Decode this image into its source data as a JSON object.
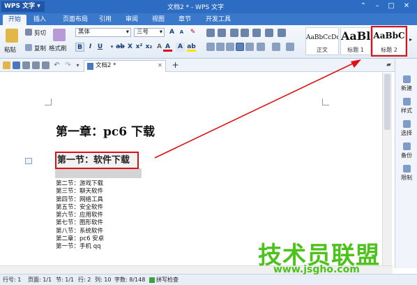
{
  "app": {
    "title": "WPS 文字",
    "doc_title": "文档2 * - WPS 文字"
  },
  "menu": [
    "开始",
    "插入",
    "页面布局",
    "引用",
    "审阅",
    "视图",
    "章节",
    "开发工具"
  ],
  "ribbon": {
    "paste": "粘贴",
    "cut": "剪切",
    "copy": "复制",
    "format_painter": "格式刷",
    "font": "黑体",
    "size": "三号",
    "styles": [
      {
        "sample": "AaBbCcDc",
        "label": "正文"
      },
      {
        "sample": "AaBl",
        "label": "标题 1"
      },
      {
        "sample": "AaBbC",
        "label": "标题 2"
      }
    ]
  },
  "doc_tab": "文档2 *",
  "sidebar": [
    "新建",
    "样式",
    "选择",
    "备份",
    "限制"
  ],
  "document": {
    "heading1": "第一章：pc6 下载",
    "heading2": "第一节：软件下载",
    "toc": [
      "第二节：游戏下载",
      "第三节：聊天软件",
      "第四节：网络工具",
      "第五节：安全软件",
      "第六节：应用软件",
      "第七节：图形软件",
      "第八节：系统软件",
      "第二章：pc6 安卓",
      "第一节：手机 qq"
    ]
  },
  "status": {
    "row": "行号: 1",
    "page": "页面: 1/1",
    "section": "节: 1/1",
    "line": "行: 2",
    "col": "列: 10",
    "words": "字数: 8/148",
    "spell": "拼写检查"
  },
  "watermark": {
    "cn": "技术员联盟",
    "url": "www.jsgho.com"
  },
  "colors": {
    "title_blue": "#2d6cc3",
    "highlight_red": "#dd1111",
    "watermark_green": "#4cc21a"
  }
}
